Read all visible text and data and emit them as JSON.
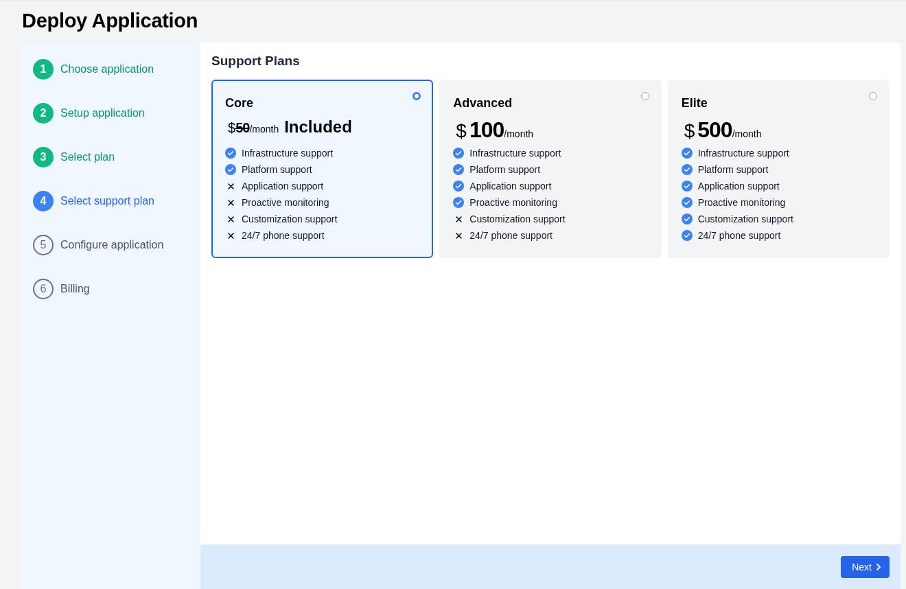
{
  "page": {
    "title": "Deploy Application"
  },
  "steps": [
    {
      "number": "1",
      "label": "Choose application",
      "completed": true,
      "current": false
    },
    {
      "number": "2",
      "label": "Setup application",
      "completed": true,
      "current": false
    },
    {
      "number": "3",
      "label": "Select plan",
      "completed": true,
      "current": false
    },
    {
      "number": "4",
      "label": "Select support plan",
      "completed": false,
      "current": true
    },
    {
      "number": "5",
      "label": "Configure application",
      "completed": false,
      "current": false
    },
    {
      "number": "6",
      "label": "Billing",
      "completed": false,
      "current": false
    }
  ],
  "section_title": "Support Plans",
  "plans": [
    {
      "name": "Core",
      "selected": true,
      "currency": "$",
      "amount": "50",
      "struck": true,
      "period": "/month",
      "note": "Included",
      "features": [
        {
          "label": "Infrastructure support",
          "included": true
        },
        {
          "label": "Platform support",
          "included": true
        },
        {
          "label": "Application support",
          "included": false
        },
        {
          "label": "Proactive monitoring",
          "included": false
        },
        {
          "label": "Customization support",
          "included": false
        },
        {
          "label": "24/7 phone support",
          "included": false
        }
      ]
    },
    {
      "name": "Advanced",
      "selected": false,
      "currency": "$",
      "amount": "100",
      "struck": false,
      "period": "/month",
      "features": [
        {
          "label": "Infrastructure support",
          "included": true
        },
        {
          "label": "Platform support",
          "included": true
        },
        {
          "label": "Application support",
          "included": true
        },
        {
          "label": "Proactive monitoring",
          "included": true
        },
        {
          "label": "Customization support",
          "included": false
        },
        {
          "label": "24/7 phone support",
          "included": false
        }
      ]
    },
    {
      "name": "Elite",
      "selected": false,
      "currency": "$",
      "amount": "500",
      "struck": false,
      "period": "/month",
      "features": [
        {
          "label": "Infrastructure support",
          "included": true
        },
        {
          "label": "Platform support",
          "included": true
        },
        {
          "label": "Application support",
          "included": true
        },
        {
          "label": "Proactive monitoring",
          "included": true
        },
        {
          "label": "Customization support",
          "included": true
        },
        {
          "label": "24/7 phone support",
          "included": true
        }
      ]
    }
  ],
  "footer": {
    "next_button": "Next"
  }
}
